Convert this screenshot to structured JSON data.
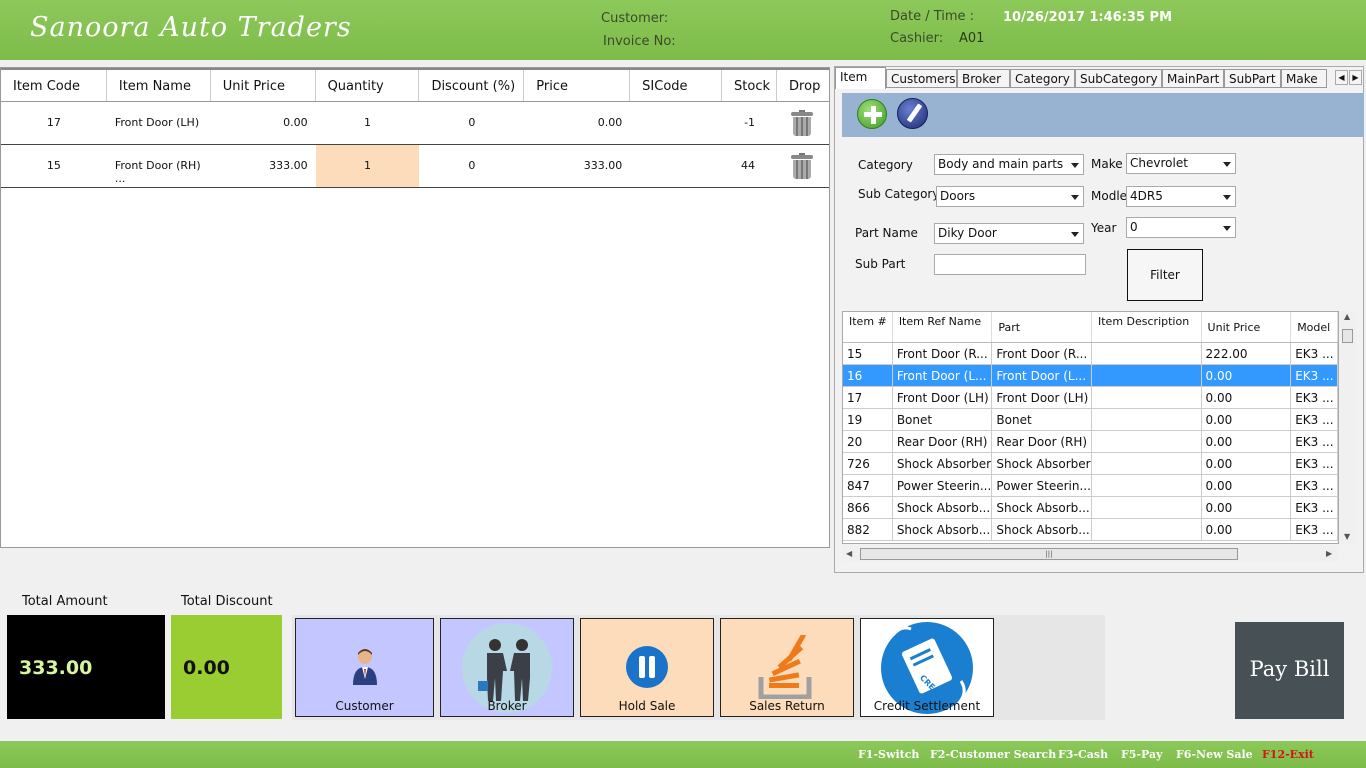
{
  "header": {
    "title": "Sanoora Auto Traders",
    "customer_label": "Customer:",
    "invoice_label": "Invoice No:",
    "datetime_label": "Date / Time :",
    "datetime_value": "10/26/2017 1:46:35 PM",
    "cashier_label": "Cashier:",
    "cashier_value": "A01"
  },
  "cart": {
    "columns": [
      "Item Code",
      "Item Name",
      "Unit Price",
      "Quantity",
      "Discount (%)",
      "Price",
      "SICode",
      "Stock",
      "Drop"
    ],
    "rows": [
      {
        "code": "17",
        "name": "Front Door (LH)",
        "unit_price": "0.00",
        "qty": "1",
        "discount": "0",
        "price": "0.00",
        "sicode": "",
        "stock": "-1"
      },
      {
        "code": "15",
        "name": "Front Door (RH) ...",
        "unit_price": "333.00",
        "qty": "1",
        "discount": "0",
        "price": "333.00",
        "sicode": "",
        "stock": "44"
      }
    ]
  },
  "tabs": [
    "Item",
    "Customers",
    "Broker",
    "Category",
    "SubCategory",
    "MainPart",
    "SubPart",
    "Make"
  ],
  "filters": {
    "category_label": "Category",
    "category_value": "Body and main parts",
    "make_label": "Make",
    "make_value": "Chevrolet",
    "subcategory_label": "Sub Category",
    "subcategory_value": "Doors",
    "model_label": "Modle",
    "model_value": "4DR5",
    "partname_label": "Part Name",
    "partname_value": "Diky Door",
    "year_label": "Year",
    "year_value": "0",
    "subpart_label": "Sub Part",
    "subpart_value": "",
    "filter_button": "Filter"
  },
  "items_grid": {
    "columns": [
      "Item #",
      "Item Ref Name",
      "Part",
      "Item Description",
      "Unit Price",
      "Model"
    ],
    "rows": [
      {
        "id": "15",
        "ref": "Front Door (R...",
        "part": "Front Door (R...",
        "desc": "",
        "price": "222.00",
        "model": "EK3 ..."
      },
      {
        "id": "16",
        "ref": "Front Door (L...",
        "part": "Front Door (L...",
        "desc": "",
        "price": "0.00",
        "model": "EK3 ..."
      },
      {
        "id": "17",
        "ref": "Front Door (LH)",
        "part": "Front Door (LH)",
        "desc": "",
        "price": "0.00",
        "model": "EK3 ..."
      },
      {
        "id": "19",
        "ref": "Bonet",
        "part": "Bonet",
        "desc": "",
        "price": "0.00",
        "model": "EK3 ..."
      },
      {
        "id": "20",
        "ref": "Rear Door (RH)",
        "part": "Rear Door (RH)",
        "desc": "",
        "price": "0.00",
        "model": "EK3 ..."
      },
      {
        "id": "726",
        "ref": "Shock Absorber",
        "part": "Shock Absorber",
        "desc": "",
        "price": "0.00",
        "model": "EK3 ..."
      },
      {
        "id": "847",
        "ref": "Power Steerin...",
        "part": "Power Steerin...",
        "desc": "",
        "price": "0.00",
        "model": "EK3 ..."
      },
      {
        "id": "866",
        "ref": "Shock Absorb...",
        "part": "Shock Absorb...",
        "desc": "",
        "price": "0.00",
        "model": "EK3 ..."
      },
      {
        "id": "882",
        "ref": "Shock Absorb...",
        "part": "Shock Absorb...",
        "desc": "",
        "price": "0.00",
        "model": "EK3 ..."
      }
    ],
    "selected_index": 1
  },
  "totals": {
    "amount_label": "Total Amount",
    "amount_value": "333.00",
    "discount_label": "Total Discount",
    "discount_value": "0.00"
  },
  "actions": {
    "customer": "Customer",
    "broker": "Broker",
    "hold_sale": "Hold Sale",
    "sales_return": "Sales Return",
    "credit_settlement": "Credit Settlement",
    "credit_stamp": "CREDIT",
    "pay_bill": "Pay Bill"
  },
  "footer": {
    "keys": [
      "F1-Switch",
      "F2-Customer Search",
      "F3-Cash",
      "F5-Pay",
      "F6-New Sale",
      "F12-Exit"
    ]
  },
  "colors": {
    "header_green": "#7dbb4a",
    "amount_bg": "#000000",
    "amount_fg": "#d8f5a0",
    "discount_bg": "#9acd32",
    "selected_row": "#3399ff",
    "customer_btn": "#c4c6ff",
    "hold_btn": "#fddcbc",
    "pay_bill_bg": "#465055",
    "exit_red": "#d41515"
  }
}
